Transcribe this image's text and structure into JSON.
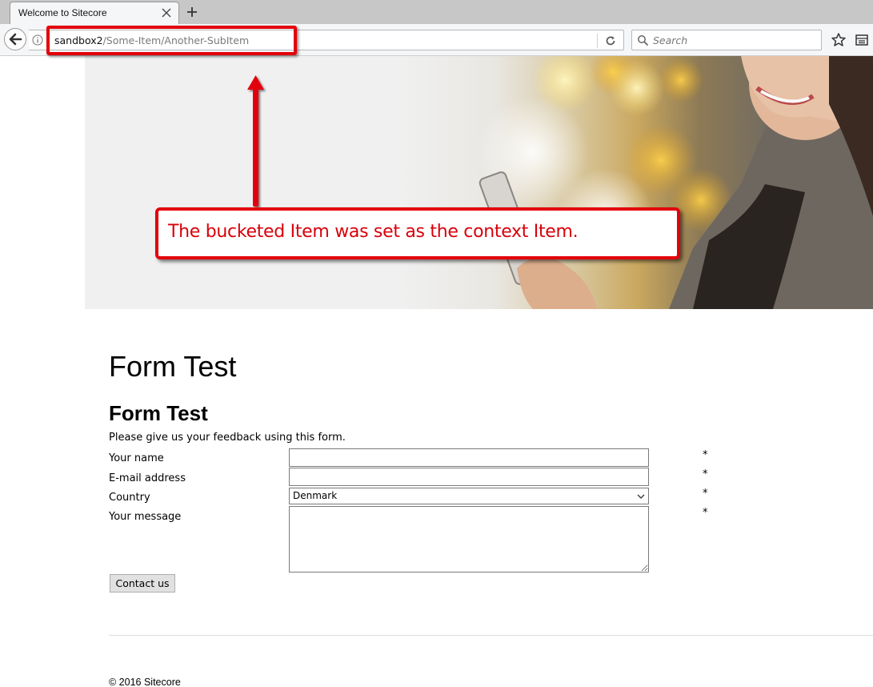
{
  "browser": {
    "tab_title": "Welcome to Sitecore",
    "url_host": "sandbox2",
    "url_path": "/Some-Item/Another-SubItem",
    "search_placeholder": "Search"
  },
  "annotation": {
    "callout_text": "The bucketed Item was set as the context Item.",
    "color": "#e3000b"
  },
  "page": {
    "title": "Form Test",
    "form_title": "Form Test",
    "intro": "Please give us your feedback using this form.",
    "fields": [
      {
        "label": "Your name",
        "value": "",
        "required": "*"
      },
      {
        "label": "E-mail address",
        "value": "",
        "required": "*"
      },
      {
        "label": "Country",
        "value": "Denmark",
        "required": "*"
      },
      {
        "label": "Your message",
        "value": "",
        "required": "*"
      }
    ],
    "submit_label": "Contact us",
    "footer": "© 2016 Sitecore"
  }
}
